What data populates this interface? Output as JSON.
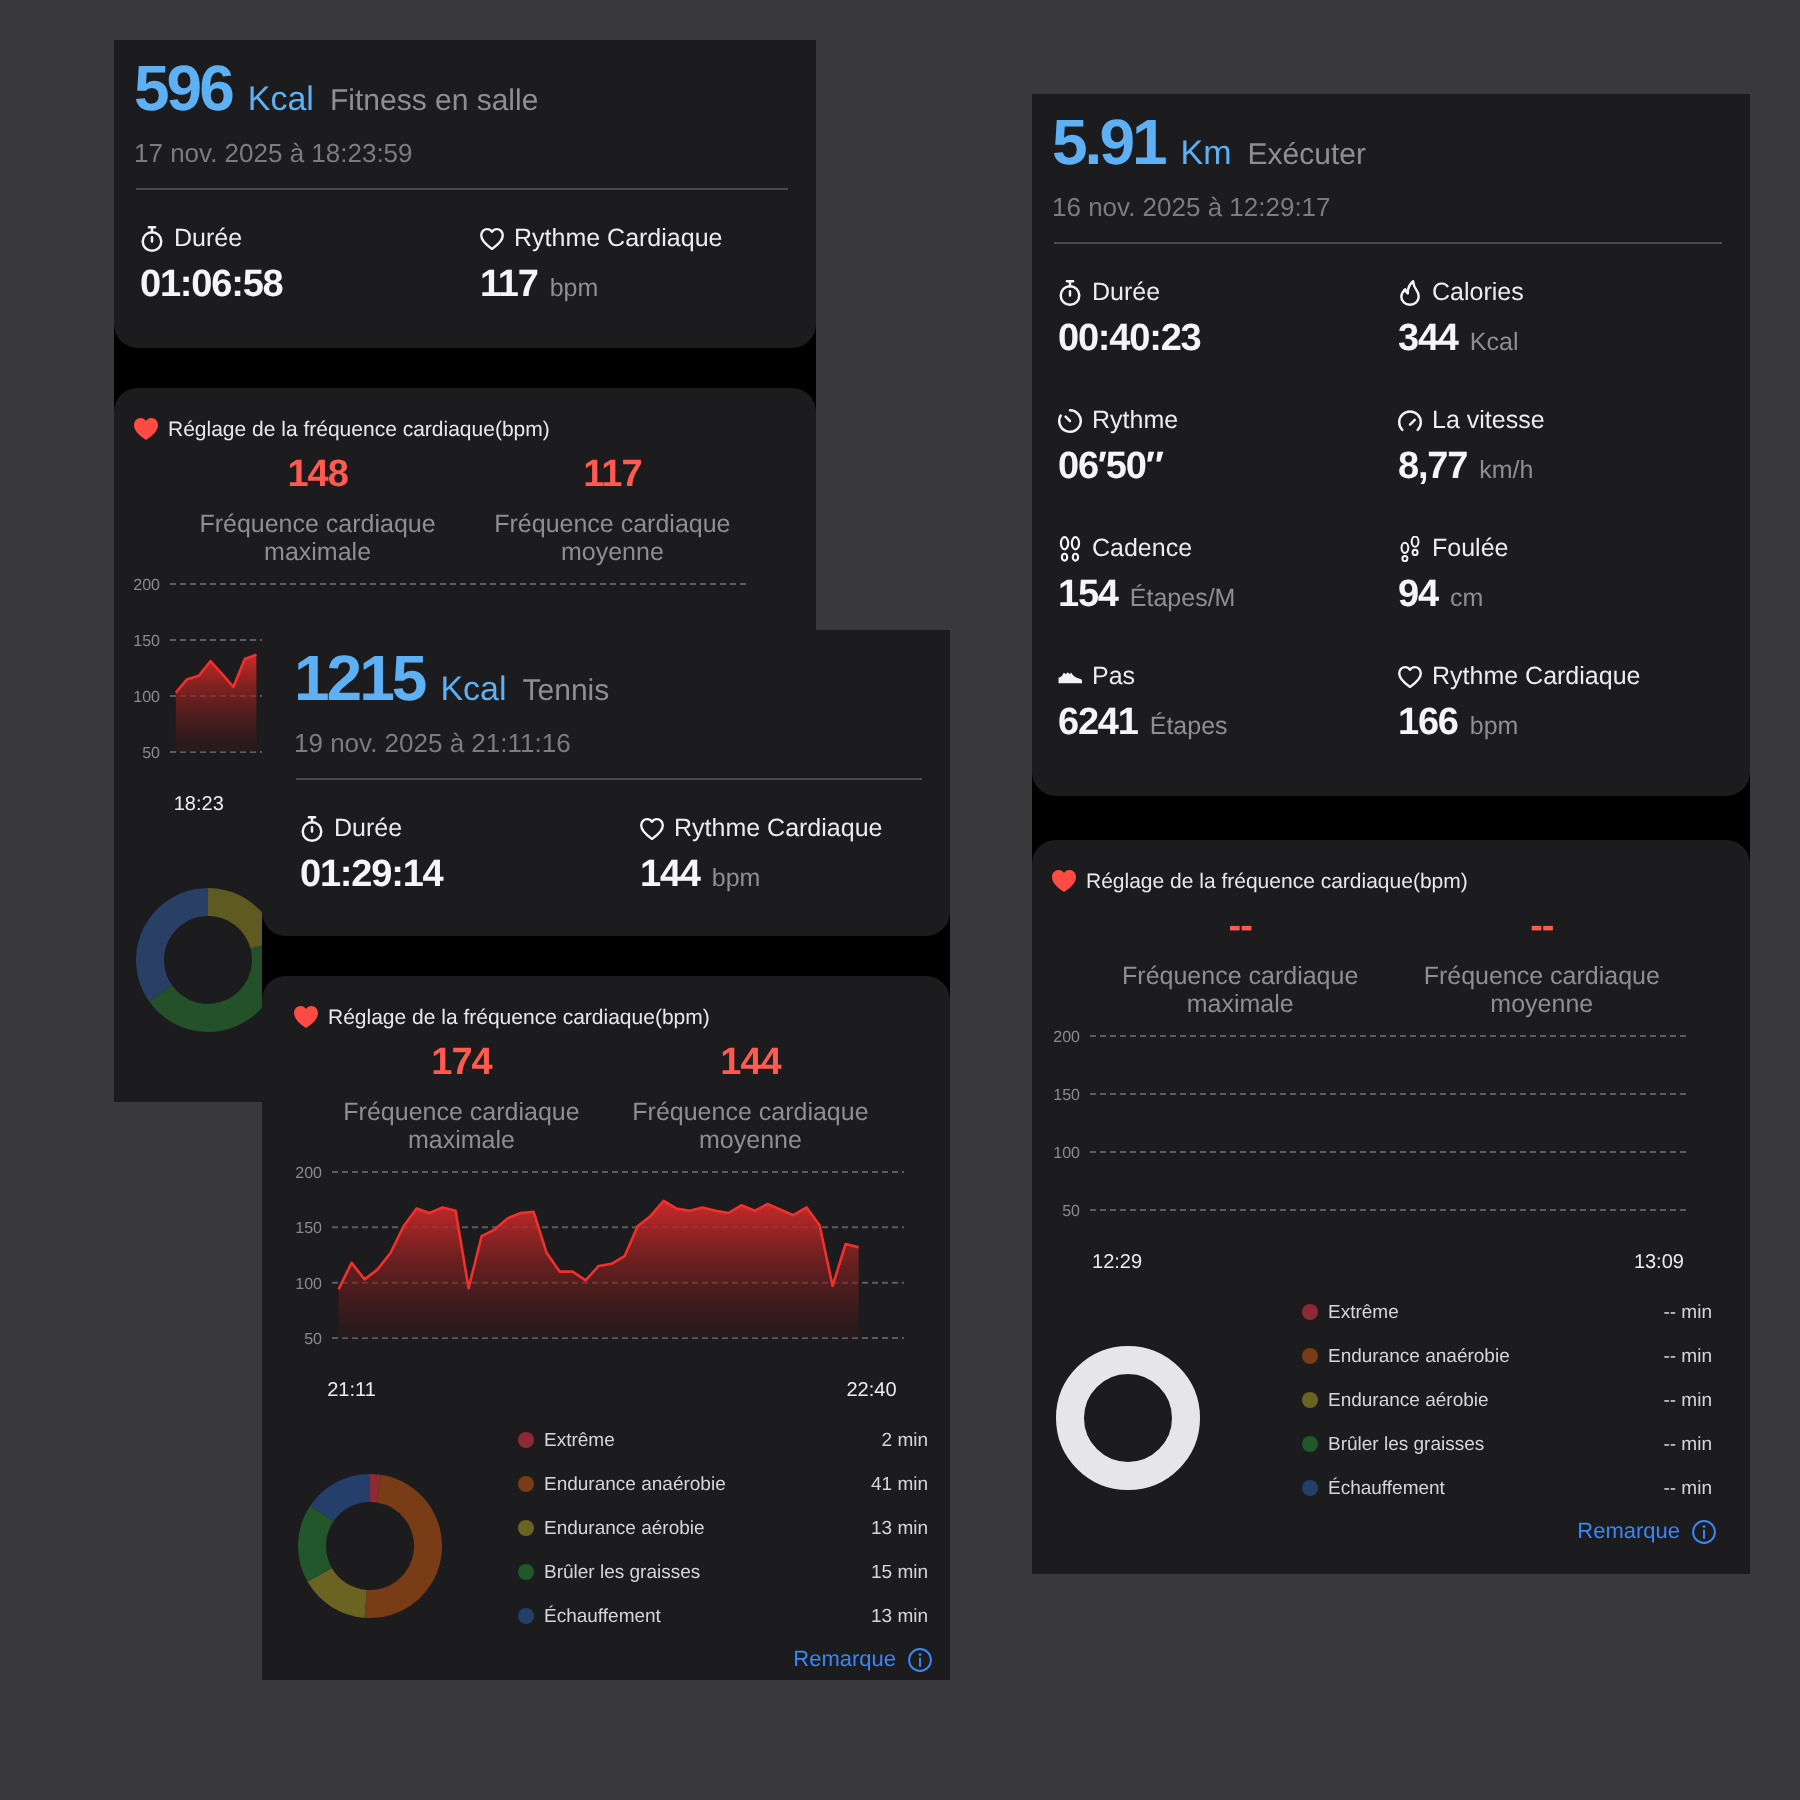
{
  "screenshots": [
    {
      "summary": {
        "value": "596",
        "unit": "Kcal",
        "activity": "Fitness en salle",
        "date": "17 nov. 2025 à 18:23:59"
      },
      "stats": [
        {
          "kind": "duration",
          "label": "Durée",
          "value": "01:06:58"
        },
        {
          "kind": "heart_rate",
          "label": "Rythme Cardiaque",
          "value": "117",
          "unit": "bpm"
        }
      ],
      "heart_rate": {
        "title": "Réglage de la fréquence cardiaque(bpm)",
        "readings": [
          {
            "value": "148",
            "caption": "Fréquence cardiaque maximale"
          },
          {
            "value": "117",
            "caption": "Fréquence cardiaque moyenne"
          }
        ],
        "chart_data": {
          "type": "area",
          "ylim": [
            50,
            200
          ],
          "yticks": [
            200,
            150,
            100,
            50
          ],
          "categories": [
            null,
            null,
            "18:23",
            null,
            null,
            null,
            null,
            null,
            null,
            null,
            null,
            null,
            null,
            null,
            null,
            null,
            null,
            null,
            null,
            null,
            null,
            null,
            null,
            null,
            null,
            null,
            null,
            null,
            null,
            null,
            null,
            null,
            null,
            null,
            null,
            null,
            null,
            null,
            null,
            null,
            null,
            null,
            null,
            null,
            null,
            null,
            null,
            null,
            null,
            null
          ],
          "values": [
            103,
            115,
            118,
            131,
            120,
            108,
            133,
            137,
            null,
            null,
            null,
            null,
            null,
            null,
            null,
            null,
            null,
            null,
            null,
            null,
            null,
            null,
            null,
            null,
            null,
            null,
            null,
            null,
            null,
            null,
            null,
            null,
            null,
            null,
            null,
            null,
            null,
            null,
            null,
            null,
            null,
            null,
            null,
            null,
            null,
            null,
            null,
            null,
            null,
            null
          ]
        }
      },
      "zones": {
        "kind": "picture"
      }
    },
    {
      "summary": {
        "value": "1215",
        "unit": "Kcal",
        "activity": "Tennis",
        "date": "19 nov. 2025 à 21:11:16"
      },
      "stats": [
        {
          "kind": "duration",
          "label": "Durée",
          "value": "01:29:14"
        },
        {
          "kind": "heart_rate",
          "label": "Rythme Cardiaque",
          "value": "144",
          "unit": "bpm"
        }
      ],
      "heart_rate": {
        "title": "Réglage de la fréquence cardiaque(bpm)",
        "readings": [
          {
            "value": "174",
            "caption": "Fréquence cardiaque maximale"
          },
          {
            "value": "144",
            "caption": "Fréquence cardiaque moyenne"
          }
        ],
        "chart_data": {
          "type": "area",
          "ylim": [
            50,
            200
          ],
          "yticks": [
            200,
            150,
            100,
            50
          ],
          "categories": [
            null,
            "21:11",
            null,
            null,
            null,
            null,
            null,
            null,
            null,
            null,
            null,
            null,
            null,
            null,
            null,
            null,
            null,
            null,
            null,
            null,
            null,
            null,
            null,
            null,
            null,
            null,
            null,
            null,
            null,
            null,
            null,
            null,
            null,
            null,
            null,
            null,
            null,
            null,
            null,
            null,
            null,
            "22:40",
            null,
            null
          ],
          "values": [
            94,
            118,
            103,
            112,
            127,
            151,
            167,
            163,
            168,
            165,
            95,
            142,
            148,
            158,
            163,
            164,
            127,
            110,
            110,
            102,
            115,
            117,
            124,
            151,
            160,
            174,
            167,
            165,
            168,
            165,
            163,
            170,
            165,
            171,
            166,
            161,
            168,
            152,
            97,
            135,
            132,
            null,
            null,
            null
          ]
        }
      },
      "zones": {
        "kind": "chart",
        "items": [
          {
            "name": "Extrême",
            "duration": "2 min",
            "color": "#8e2a33"
          },
          {
            "name": "Endurance anaérobie",
            "duration": "41 min",
            "color": "#7a3c16"
          },
          {
            "name": "Endurance aérobie",
            "duration": "13 min",
            "color": "#6b6322"
          },
          {
            "name": "Brûler les graisses",
            "duration": "15 min",
            "color": "#21572b"
          },
          {
            "name": "Échauffement",
            "duration": "13 min",
            "color": "#243f6b"
          }
        ],
        "chart_data": {
          "type": "donut",
          "values": [
            2.4,
            48.8,
            15.5,
            17.8,
            15.5
          ]
        }
      },
      "note_link": "Remarque"
    },
    {
      "summary": {
        "value": "5.91",
        "unit": "Km",
        "activity": "Exécuter",
        "date": "16 nov. 2025 à 12:29:17"
      },
      "stats": [
        {
          "kind": "duration",
          "label": "Durée",
          "value": "00:40:23"
        },
        {
          "kind": "calories",
          "label": "Calories",
          "value": "344",
          "unit": "Kcal"
        },
        {
          "kind": "pace",
          "label": "Rythme",
          "value": "06′50″"
        },
        {
          "kind": "speed",
          "label": "La vitesse",
          "value": "8,77",
          "unit": "km/h"
        },
        {
          "kind": "cadence",
          "label": "Cadence",
          "value": "154",
          "unit": "Étapes/M"
        },
        {
          "kind": "stride",
          "label": "Foulée",
          "value": "94",
          "unit": "cm"
        },
        {
          "kind": "steps",
          "label": "Pas",
          "value": "6241",
          "unit": "Étapes"
        },
        {
          "kind": "heart_rate",
          "label": "Rythme Cardiaque",
          "value": "166",
          "unit": "bpm"
        }
      ],
      "heart_rate": {
        "title": "Réglage de la fréquence cardiaque(bpm)",
        "readings": [
          {
            "value": "--",
            "caption": "Fréquence cardiaque maximale"
          },
          {
            "value": "--",
            "caption": "Fréquence cardiaque moyenne"
          }
        ],
        "chart_data": {
          "type": "area",
          "ylim": [
            50,
            200
          ],
          "yticks": [
            200,
            150,
            100,
            50
          ],
          "categories": [
            "12:29",
            null,
            null,
            null,
            null,
            null,
            null,
            null,
            null,
            null,
            "13:09"
          ]
        }
      },
      "zones": {
        "kind": "empty",
        "items": [
          {
            "name": "Extrême",
            "duration": "-- min",
            "color": "#8e2a33"
          },
          {
            "name": "Endurance anaérobie",
            "duration": "-- min",
            "color": "#7a3c16"
          },
          {
            "name": "Endurance aérobie",
            "duration": "-- min",
            "color": "#6b6322"
          },
          {
            "name": "Brûler les graisses",
            "duration": "-- min",
            "color": "#21572b"
          },
          {
            "name": "Échauffement",
            "duration": "-- min",
            "color": "#243f6b"
          }
        ]
      },
      "note_link": "Remarque"
    }
  ]
}
